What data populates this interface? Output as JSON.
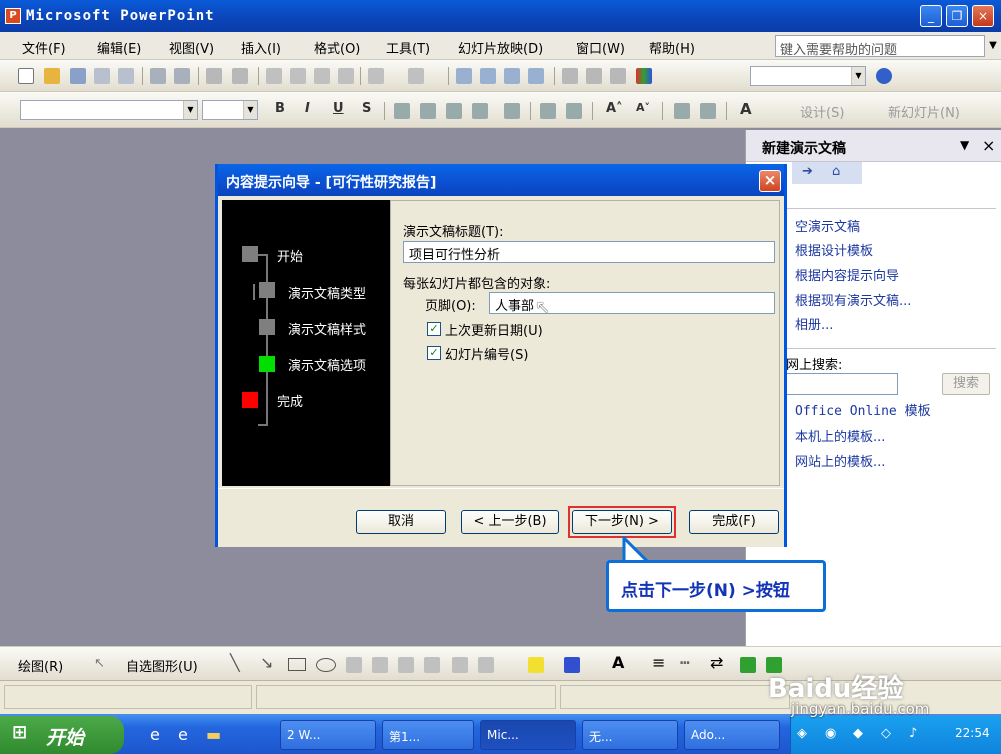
{
  "window": {
    "title": "Microsoft PowerPoint",
    "app_icon": "P",
    "minimize": "_",
    "maximize": "❐",
    "close": "×"
  },
  "menu": {
    "items": [
      "文件(F)",
      "编辑(E)",
      "视图(V)",
      "插入(I)",
      "格式(O)",
      "工具(T)",
      "幻灯片放映(D)",
      "窗口(W)",
      "帮助(H)"
    ],
    "help_placeholder": "键入需要帮助的问题"
  },
  "format_toolbar": {
    "bold": "B",
    "italic": "I",
    "underline": "U",
    "shadow": "S",
    "grow": "A˄",
    "shrink": "A˅",
    "font_color": "A",
    "design": "设计(S)",
    "new_slide": "新幻灯片(N)"
  },
  "task_pane": {
    "title": "新建演示文稿",
    "links": [
      "空演示文稿",
      "根据设计模板",
      "根据内容提示向导",
      "根据现有演示文稿...",
      "相册..."
    ],
    "search_label": "网上搜索:",
    "search_button": "搜索",
    "template_links": [
      "Office Online 模板",
      "本机上的模板...",
      "网站上的模板..."
    ]
  },
  "dialog": {
    "title": "内容提示向导 - [可行性研究报告]",
    "steps": [
      {
        "label": "开始",
        "color": "#7f7f7f"
      },
      {
        "label": "演示文稿类型",
        "color": "#7f7f7f"
      },
      {
        "label": "演示文稿样式",
        "color": "#7f7f7f"
      },
      {
        "label": "演示文稿选项",
        "color": "#00e000"
      },
      {
        "label": "完成",
        "color": "#ff0000"
      }
    ],
    "title_label": "演示文稿标题(T):",
    "title_value": "项目可行性分析",
    "objects_label": "每张幻灯片都包含的对象:",
    "footer_label": "页脚(O):",
    "footer_value": "人事部",
    "check_date": "上次更新日期(U)",
    "check_number": "幻灯片编号(S)",
    "check_date_checked": true,
    "check_number_checked": true,
    "buttons": {
      "cancel": "取消",
      "back": "< 上一步(B)",
      "next": "下一步(N) >",
      "finish": "完成(F)"
    }
  },
  "callout": {
    "text": "点击下一步(N) >按钮"
  },
  "draw_toolbar": {
    "draw": "绘图(R)",
    "autoshapes": "自选图形(U)"
  },
  "taskbar": {
    "start": "开始",
    "tasks": [
      "2 W...",
      "第1...",
      "Mic...",
      "无...",
      "Ado..."
    ],
    "time": "22:54"
  },
  "watermark": {
    "text": "Baidu经验",
    "url": "jingyan.baidu.com"
  }
}
